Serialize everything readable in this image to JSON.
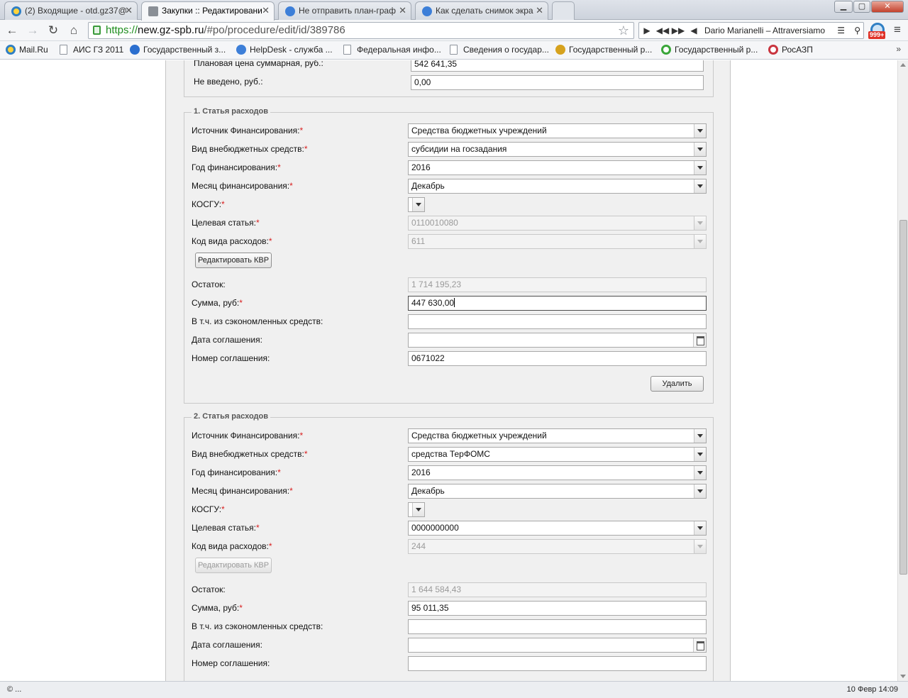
{
  "browser": {
    "tabs": [
      {
        "title": "(2) Входящие - otd.gz37@",
        "icon": "mail-icon"
      },
      {
        "title": "Закупки :: Редактировани",
        "icon": "tools-icon"
      },
      {
        "title": "Не отправить план-граф",
        "icon": "help-icon"
      },
      {
        "title": "Как сделать снимок экра",
        "icon": "help-icon"
      }
    ],
    "close_glyph": "✕",
    "url": {
      "scheme": "https://",
      "host": "new.gz-spb.ru",
      "path": "/#po/procedure/edit/id/389786"
    },
    "player_track": "Dario Marianelli – Attraversiamo",
    "ext_badge": "999+",
    "bookmarks": [
      {
        "label": "Mail.Ru",
        "icon": "mail"
      },
      {
        "label": "АИС ГЗ 2011",
        "icon": "page"
      },
      {
        "label": "Государственный з...",
        "icon": "globe"
      },
      {
        "label": "HelpDesk - служба ...",
        "icon": "help"
      },
      {
        "label": "Федеральная инфо...",
        "icon": "page"
      },
      {
        "label": "Сведения о государ...",
        "icon": "page"
      },
      {
        "label": "Государственный р...",
        "icon": "coin"
      },
      {
        "label": "Государственный р...",
        "icon": "green"
      },
      {
        "label": "РосАЗП",
        "icon": "ros"
      }
    ],
    "bookmarks_more": "»",
    "status_left": "© ...",
    "status_right": "10 Февр 14:09"
  },
  "form": {
    "top": {
      "planned_label": "Плановая цена суммарная, руб.:",
      "planned_value": "542 641,35",
      "not_entered_label": "Не введено, руб.:",
      "not_entered_value": "0,00"
    },
    "labels": {
      "source": "Источник Финансирования:",
      "kind": "Вид внебюджетных средств:",
      "year": "Год финансирования:",
      "month": "Месяц финансирования:",
      "kosgu": "КОСГУ:",
      "target": "Целевая статья:",
      "kvr": "Код вида расходов:",
      "edit_kvr": "Редактировать КВР",
      "balance": "Остаток:",
      "sum": "Сумма, руб:",
      "saved": "В т.ч. из сэкономленных средств:",
      "agreement_date": "Дата соглашения:",
      "agreement_number": "Номер соглашения:",
      "required": "*"
    },
    "items": [
      {
        "legend": "1. Статья расходов",
        "source": "Средства бюджетных учреждений",
        "kind": "субсидии на госзадания",
        "year": "2016",
        "month": "Декабрь",
        "kosgu": "",
        "target": "0110010080",
        "kvr": "611",
        "balance": "1 714 195,23",
        "sum": "447 630,00",
        "saved": "",
        "agreement_date": "",
        "agreement_number": "0671022",
        "delete": "Удалить"
      },
      {
        "legend": "2. Статья расходов",
        "source": "Средства бюджетных учреждений",
        "kind": "средства ТерФОМС",
        "year": "2016",
        "month": "Декабрь",
        "kosgu": "",
        "target": "0000000000",
        "kvr": "244",
        "balance": "1 644 584,43",
        "sum": "95 011,35",
        "saved": "",
        "agreement_date": "",
        "agreement_number": ""
      }
    ]
  }
}
